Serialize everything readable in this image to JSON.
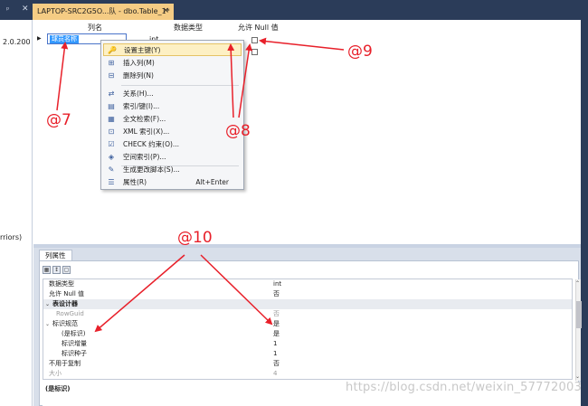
{
  "window": {
    "pin_glyph": "ᵖ",
    "close_glyph": "✕",
    "tab_title": "LAPTOP-SRC2G5O...队 - dbo.Table_1*",
    "tab_close": "×"
  },
  "left_strip": {
    "text1": "2.0.200",
    "text2": "rriors)"
  },
  "designer": {
    "headers": {
      "column_name": "列名",
      "data_type": "数据类型",
      "allow_null": "允许 Null 值"
    },
    "row_arrow": "▶",
    "edit_value": "球员名称",
    "type_value": "int"
  },
  "context_menu": {
    "items": [
      {
        "icon": "🔑",
        "label": "设置主键(Y)"
      },
      {
        "icon": "⊞",
        "label": "插入列(M)"
      },
      {
        "icon": "⊟",
        "label": "删除列(N)"
      },
      {
        "icon": "⇄",
        "label": "关系(H)..."
      },
      {
        "icon": "▤",
        "label": "索引/键(I)..."
      },
      {
        "icon": "▦",
        "label": "全文检索(F)..."
      },
      {
        "icon": "⊡",
        "label": "XML 索引(X)..."
      },
      {
        "icon": "☑",
        "label": "CHECK 约束(O)..."
      },
      {
        "icon": "◈",
        "label": "空间索引(P)..."
      },
      {
        "icon": "✎",
        "label": "生成更改脚本(S)..."
      },
      {
        "icon": "☰",
        "label": "属性(R)",
        "shortcut": "Alt+Enter"
      }
    ]
  },
  "properties": {
    "tab_label": "列属性",
    "tool_icons": [
      "▦",
      "↕",
      "▢"
    ],
    "rows": [
      {
        "name": "数据类型",
        "value": "int"
      },
      {
        "name": "允许 Null 值",
        "value": "否"
      },
      {
        "name": "表设计器",
        "value": ""
      },
      {
        "name": "RowGuid",
        "value": "否"
      },
      {
        "name": "标识规范",
        "value": "是"
      },
      {
        "name": "(是标识)",
        "value": "是"
      },
      {
        "name": "标识增量",
        "value": "1"
      },
      {
        "name": "标识种子",
        "value": "1"
      },
      {
        "name": "不用于复制",
        "value": "否"
      },
      {
        "name": "大小",
        "value": "4"
      }
    ],
    "twist": "⌄",
    "scroll_up": "⌃",
    "scroll_down": "⌄",
    "description_title": "(是标识)"
  },
  "annotations": {
    "a7": "@7",
    "a8": "@8",
    "a9": "@9",
    "a10": "@10"
  },
  "watermark": "https://blog.csdn.net/weixin_57772003",
  "colors": {
    "accent_red": "#e8202a",
    "title_bar": "#2b3c59",
    "tab_active": "#f5cc84",
    "menu_highlight": "#fdf0c4"
  }
}
